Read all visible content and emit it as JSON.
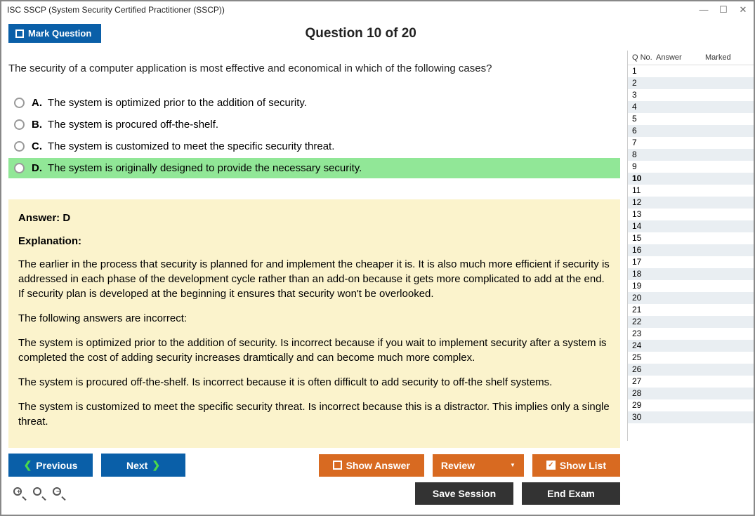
{
  "window": {
    "title": "ISC SSCP (System Security Certified Practitioner (SSCP))"
  },
  "header": {
    "mark_label": "Mark Question",
    "question_title": "Question 10 of 20"
  },
  "question": {
    "text": "The security of a computer application is most effective and economical in which of the following cases?",
    "options": [
      {
        "letter": "A.",
        "text": "The system is optimized prior to the addition of security.",
        "selected": false
      },
      {
        "letter": "B.",
        "text": "The system is procured off-the-shelf.",
        "selected": false
      },
      {
        "letter": "C.",
        "text": "The system is customized to meet the specific security threat.",
        "selected": false
      },
      {
        "letter": "D.",
        "text": "The system is originally designed to provide the necessary security.",
        "selected": true
      }
    ]
  },
  "answer": {
    "label": "Answer: D",
    "exp_label": "Explanation:",
    "paragraphs": [
      "The earlier in the process that security is planned for and implement the cheaper it is. It is also much more efficient if security is addressed in each phase of the development cycle rather than an add-on because it gets more complicated to add at the end. If security plan is developed at the beginning it ensures that security won't be overlooked.",
      "The following answers are incorrect:",
      "The system is optimized prior to the addition of security. Is incorrect because if you wait to implement security after a system is completed the cost of adding security increases dramtically and can become much more complex.",
      "The system is procured off-the-shelf. Is incorrect because it is often difficult to add security to off-the shelf systems.",
      "The system is customized to meet the specific security threat. Is incorrect because this is a distractor. This implies only a single threat."
    ]
  },
  "buttons": {
    "previous": "Previous",
    "next": "Next",
    "show_answer": "Show Answer",
    "review": "Review",
    "show_list": "Show List",
    "save_session": "Save Session",
    "end_exam": "End Exam"
  },
  "sidebar": {
    "headers": {
      "qno": "Q No.",
      "answer": "Answer",
      "marked": "Marked"
    },
    "total": 30,
    "current": 10
  }
}
